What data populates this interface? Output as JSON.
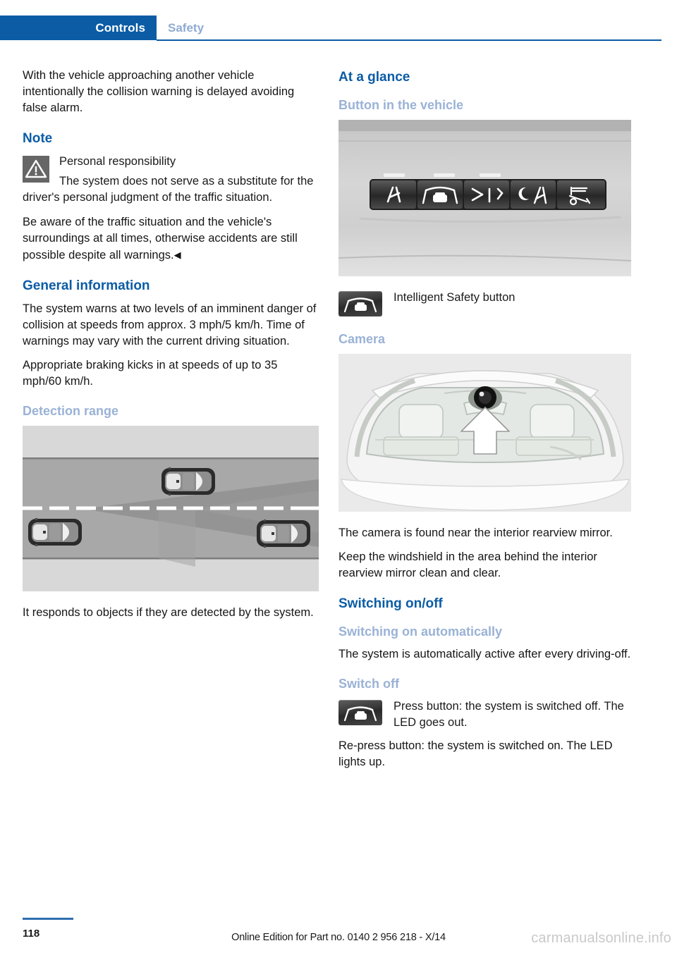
{
  "header": {
    "active_tab": "Controls",
    "inactive_tab": "Safety",
    "active_color": "#0b5ca5",
    "inactive_color": "#8fabd4"
  },
  "left_column": {
    "intro_paragraph": "With the vehicle approaching another vehicle intentionally the collision warning is delayed avoiding false alarm.",
    "note_heading": "Note",
    "note_icon": "warning-triangle-icon",
    "note_title": "Personal responsibility",
    "note_body_1": "The system does not serve as a substitute for the driver's personal judgment of the traffic situation.",
    "note_body_2": "Be aware of the traffic situation and the vehicle's surroundings at all times, otherwise accidents are still possible despite all warnings.",
    "note_end_mark": "◀",
    "general_heading": "General information",
    "general_paragraph_1": "The system warns at two levels of an imminent danger of collision at speeds from approx. 3 mph/5 km/h. Time of warnings may vary with the current driving situation.",
    "general_paragraph_2": "Appropriate braking kicks in at speeds of up to 35 mph/60 km/h.",
    "detection_heading": "Detection range",
    "detection_figure_alt": "detection-range-diagram",
    "detection_caption": "It responds to objects if they are detected by the system."
  },
  "right_column": {
    "at_a_glance_heading": "At a glance",
    "button_heading": "Button in the vehicle",
    "button_figure_alt": "dashboard-button-panel-photo",
    "button_icon": "intelligent-safety-button-icon",
    "button_label": "Intelligent Safety button",
    "camera_heading": "Camera",
    "camera_figure_alt": "windshield-camera-illustration",
    "camera_paragraph_1": "The camera is found near the interior rearview mirror.",
    "camera_paragraph_2": "Keep the windshield in the area behind the interior rearview mirror clean and clear.",
    "switching_heading": "Switching on/off",
    "switching_auto_heading": "Switching on automatically",
    "switching_auto_paragraph": "The system is automatically active after every driving-off.",
    "switch_off_heading": "Switch off",
    "switch_off_icon": "intelligent-safety-button-icon",
    "switch_off_paragraph": "Press button: the system is switched off. The LED goes out.",
    "switch_off_paragraph_2": "Re-press button: the system is switched on. The LED lights up."
  },
  "footer": {
    "page_number": "118",
    "edition_text": "Online Edition for Part no. 0140 2 956 218 - X/14",
    "watermark": "carmanualsonline.info"
  }
}
